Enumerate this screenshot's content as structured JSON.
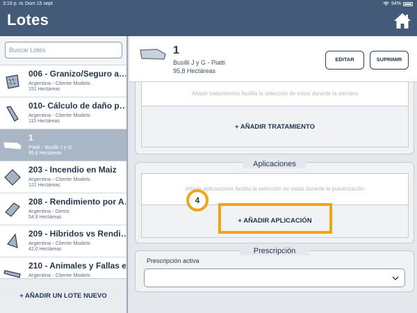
{
  "status_bar": {
    "time": "3:19 p. m.",
    "date": "Dom 15 sept",
    "battery": "94%"
  },
  "header": {
    "title": "Lotes"
  },
  "sidebar": {
    "search_placeholder": "Buscar Lotes",
    "items": [
      {
        "name": "006 - Granizo/Seguro a…",
        "sub": "Argentina - Cliente Modelo",
        "area": "151 Hectáreas",
        "icon": "field-shape-icon"
      },
      {
        "name": "010- Cálculo de daño p…",
        "sub": "Argentina - Cliente Modelo",
        "area": "115 Hectáreas",
        "icon": "field-shape-icon"
      },
      {
        "name": "1",
        "sub": "Piatti - Busilli J y G",
        "area": "95,8 Hectáreas",
        "icon": "field-shape-icon",
        "selected": true
      },
      {
        "name": "203 - Incendio en Maiz",
        "sub": "Argentina - Cliente Modelo",
        "area": "121 Hectáreas",
        "icon": "field-shape-icon"
      },
      {
        "name": "208 - Rendimiento por A…",
        "sub": "Argentina - Demo",
        "area": "54,9 Hectáreas",
        "icon": "field-shape-icon"
      },
      {
        "name": "209 - Híbridos vs Rendi…",
        "sub": "Argentina - Cliente Modelo",
        "area": "42,0 Hectáreas",
        "icon": "field-shape-icon"
      },
      {
        "name": "210 - Animales y Fallas e…",
        "sub": "Argentina - Cliente Modelo",
        "area": "",
        "icon": "field-shape-icon"
      }
    ],
    "add_label": "+ AÑADIR UN LOTE NUEVO"
  },
  "detail": {
    "name": "1",
    "sub": "Busilli J y G - Piatti",
    "area": "95,8 Hectáreas",
    "edit_label": "EDITAR",
    "delete_label": "SUPRIMIR"
  },
  "tratamientos": {
    "hint": "Añadir tratamientos facilita la selección de estos durante la siembra",
    "add_label": "+ AÑADIR TRATAMIENTO"
  },
  "aplicaciones": {
    "title": "Aplicaciones",
    "hint": "Añadir aplicaciones facilita la selección de estas durante la pulverización",
    "add_label": "+ AÑADIR APLICACIÓN",
    "step_number": "4"
  },
  "prescripcion": {
    "title": "Prescripción",
    "label": "Prescripción activa",
    "value": ""
  },
  "colors": {
    "header": "#435b79",
    "accent": "#f2a414",
    "selected": "#a9b6c6",
    "text": "#1f3550"
  }
}
